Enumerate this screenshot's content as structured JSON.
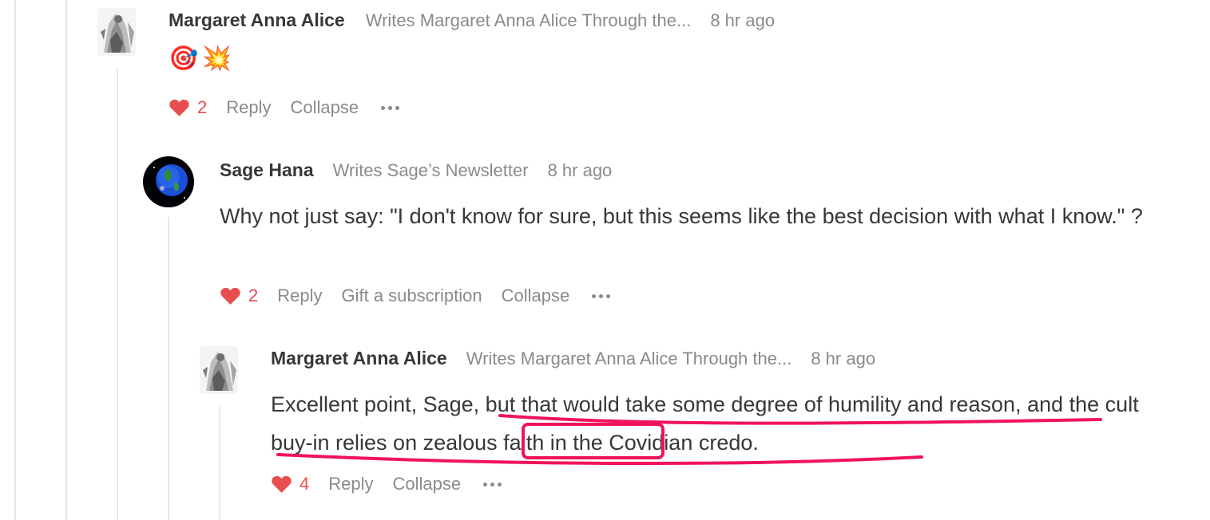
{
  "comments": [
    {
      "author": "Margaret Anna Alice",
      "publication": "Writes Margaret Anna Alice Through the...",
      "time": "8 hr ago",
      "emoji": [
        "🎯",
        "💥"
      ],
      "likes": "2",
      "actions": {
        "reply": "Reply",
        "collapse": "Collapse"
      }
    },
    {
      "author": "Sage Hana",
      "publication": "Writes Sage’s Newsletter",
      "time": "8 hr ago",
      "text": "Why not just say: \"I don't know for sure, but this seems like the best decision with what I know.\" ?",
      "likes": "2",
      "actions": {
        "reply": "Reply",
        "gift": "Gift a subscription",
        "collapse": "Collapse"
      }
    },
    {
      "author": "Margaret Anna Alice",
      "publication": "Writes Margaret Anna Alice Through the...",
      "time": "8 hr ago",
      "text_parts": {
        "p1": "Excellent point, Sage, ",
        "p2": "but that would take some degree of humility and reason",
        "p3": ", and ",
        "p4": "the cult buy-in relies on ",
        "p5": "zealous faith",
        "p6": " in the Covidian credo."
      },
      "likes": "4",
      "actions": {
        "reply": "Reply",
        "collapse": "Collapse"
      }
    }
  ],
  "colors": {
    "heart": "#e84e4e",
    "annotation": "#f0145a",
    "muted": "#8a8a8a",
    "text": "#363737"
  },
  "icons": [
    "heart-icon",
    "more-icon",
    "avatar-engraving",
    "avatar-earth"
  ]
}
